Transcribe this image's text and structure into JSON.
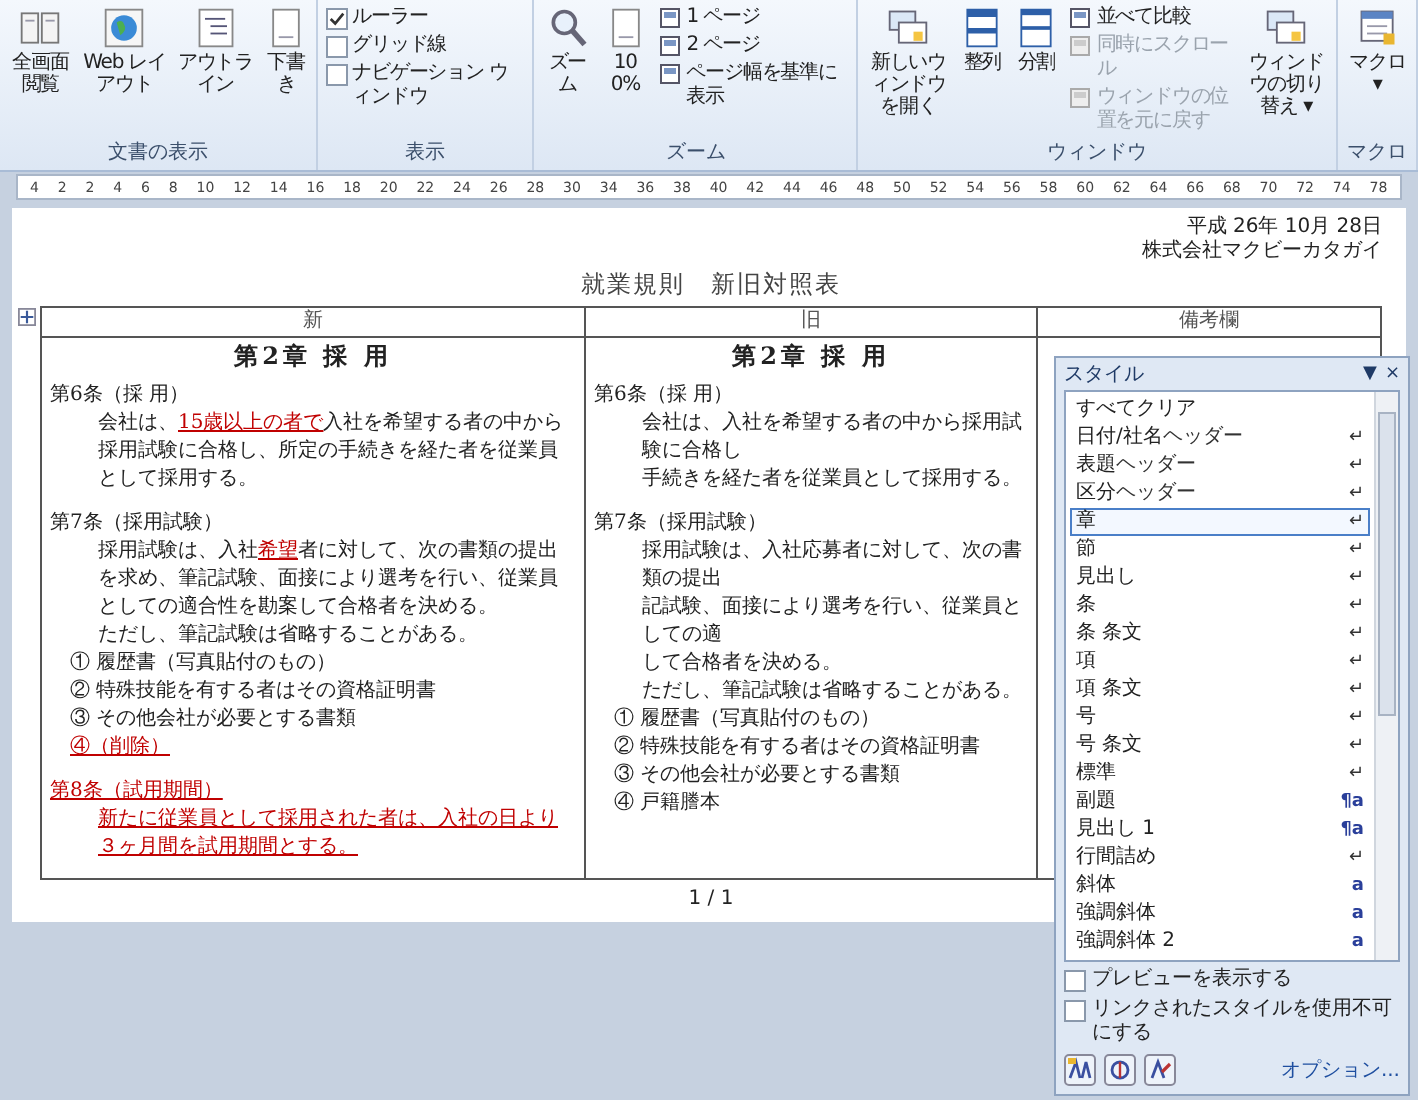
{
  "ribbon": {
    "groups": [
      {
        "label": "文書の表示",
        "columns": [
          {
            "kind": "large",
            "label": "全画面閲覧"
          },
          {
            "kind": "large",
            "label": "Web レイアウト"
          },
          {
            "kind": "large",
            "label": "アウトライン"
          },
          {
            "kind": "large",
            "label": "下書き"
          }
        ]
      },
      {
        "label": "表示",
        "columns": [
          {
            "kind": "stack",
            "items": [
              {
                "kind": "check",
                "label": "ルーラー",
                "checked": true
              },
              {
                "kind": "check",
                "label": "グリッド線",
                "checked": false
              },
              {
                "kind": "check",
                "label": "ナビゲーション ウィンドウ",
                "checked": false
              }
            ]
          }
        ]
      },
      {
        "label": "ズーム",
        "columns": [
          {
            "kind": "large",
            "label": "ズーム"
          },
          {
            "kind": "large",
            "label": "100%"
          },
          {
            "kind": "stack",
            "items": [
              {
                "kind": "small",
                "label": "1 ページ",
                "disabled": false
              },
              {
                "kind": "small",
                "label": "2 ページ",
                "disabled": false
              },
              {
                "kind": "small",
                "label": "ページ幅を基準に表示",
                "disabled": false
              }
            ]
          }
        ]
      },
      {
        "label": "ウィンドウ",
        "columns": [
          {
            "kind": "large",
            "label": "新しいウィンドウを開く"
          },
          {
            "kind": "large",
            "label": "整列"
          },
          {
            "kind": "large",
            "label": "分割"
          },
          {
            "kind": "stack",
            "items": [
              {
                "kind": "small",
                "label": "並べて比較",
                "disabled": false
              },
              {
                "kind": "small",
                "label": "同時にスクロール",
                "disabled": true
              },
              {
                "kind": "small",
                "label": "ウィンドウの位置を元に戻す",
                "disabled": true
              }
            ]
          },
          {
            "kind": "large",
            "label": "ウィンドウの切り替え ▾"
          }
        ]
      },
      {
        "label": "マクロ",
        "columns": [
          {
            "kind": "large",
            "label": "マクロ ▾"
          }
        ]
      }
    ]
  },
  "ruler": [
    "4",
    "2",
    "2",
    "4",
    "6",
    "8",
    "10",
    "12",
    "14",
    "16",
    "18",
    "20",
    "22",
    "24",
    "26",
    "28",
    "30",
    "34",
    "36",
    "38",
    "40",
    "42",
    "44",
    "46",
    "48",
    "50",
    "52",
    "54",
    "56",
    "58",
    "60",
    "62",
    "64",
    "66",
    "68",
    "70",
    "72",
    "74",
    "78"
  ],
  "document": {
    "date": "平成 26年 10月 28日",
    "company": "株式会社マクビーカタガイ",
    "title": "就業規則　新旧対照表",
    "columns": [
      {
        "header": "新",
        "lines": [
          {
            "kind": "chapter",
            "parts": [
              {
                "text": "第2章 採 用",
                "revised": false
              }
            ]
          },
          {
            "kind": "article",
            "parts": [
              {
                "text": "第6条（採 用）",
                "revised": false
              }
            ]
          },
          {
            "kind": "body",
            "parts": [
              {
                "text": "会社は、",
                "revised": false
              },
              {
                "text": "15歳以上の者で",
                "revised": true
              },
              {
                "text": "入社を希望する者の中から採用試験に合格し、所定の手続きを経た者を従業員として採用する。",
                "revised": false
              }
            ]
          },
          {
            "kind": "article",
            "parts": [
              {
                "text": "第7条（採用試験）",
                "revised": false
              }
            ]
          },
          {
            "kind": "body",
            "parts": [
              {
                "text": "採用試験は、入社",
                "revised": false
              },
              {
                "text": "希望",
                "revised": true
              },
              {
                "text": "者に対して、次の書類の提出を求め、筆記試験、面接により選考を行い、従業員としての適合性を勘案して合格者を決める。",
                "revised": false
              }
            ]
          },
          {
            "kind": "body",
            "parts": [
              {
                "text": "ただし、筆記試験は省略することがある。",
                "revised": false
              }
            ]
          },
          {
            "kind": "item",
            "parts": [
              {
                "text": "① 履歴書（写真貼付のもの）",
                "revised": false
              }
            ]
          },
          {
            "kind": "item",
            "parts": [
              {
                "text": "② 特殊技能を有する者はその資格証明書",
                "revised": false
              }
            ]
          },
          {
            "kind": "item",
            "parts": [
              {
                "text": "③ その他会社が必要とする書類",
                "revised": false
              }
            ]
          },
          {
            "kind": "item",
            "parts": [
              {
                "text": "④（削除）",
                "revised": true
              }
            ]
          },
          {
            "kind": "article",
            "parts": [
              {
                "text": "第8条（試用期間）",
                "revised": true
              }
            ]
          },
          {
            "kind": "body",
            "parts": [
              {
                "text": "新たに従業員として採用された者は、入社の日より３ヶ月間を試用期間とする。",
                "revised": true
              }
            ]
          }
        ]
      },
      {
        "header": "旧",
        "lines": [
          {
            "kind": "chapter",
            "parts": [
              {
                "text": "第2章 採 用",
                "revised": false
              }
            ]
          },
          {
            "kind": "article",
            "parts": [
              {
                "text": "第6条（採 用）",
                "revised": false
              }
            ]
          },
          {
            "kind": "body",
            "parts": [
              {
                "text": "会社は、入社を希望する者の中から採用試験に合格し",
                "revised": false
              }
            ]
          },
          {
            "kind": "body",
            "parts": [
              {
                "text": "手続きを経た者を従業員として採用する。",
                "revised": false
              }
            ]
          },
          {
            "kind": "article",
            "parts": [
              {
                "text": "第7条（採用試験）",
                "revised": false
              }
            ]
          },
          {
            "kind": "body",
            "parts": [
              {
                "text": "採用試験は、入社応募者に対して、次の書類の提出",
                "revised": false
              }
            ]
          },
          {
            "kind": "body",
            "parts": [
              {
                "text": "記試験、面接により選考を行い、従業員としての適",
                "revised": false
              }
            ]
          },
          {
            "kind": "body",
            "parts": [
              {
                "text": "して合格者を決める。",
                "revised": false
              }
            ]
          },
          {
            "kind": "body",
            "parts": [
              {
                "text": "ただし、筆記試験は省略することがある。",
                "revised": false
              }
            ]
          },
          {
            "kind": "item",
            "parts": [
              {
                "text": "① 履歴書（写真貼付のもの）",
                "revised": false
              }
            ]
          },
          {
            "kind": "item",
            "parts": [
              {
                "text": "② 特殊技能を有する者はその資格証明書",
                "revised": false
              }
            ]
          },
          {
            "kind": "item",
            "parts": [
              {
                "text": "③ その他会社が必要とする書類",
                "revised": false
              }
            ]
          },
          {
            "kind": "item",
            "parts": [
              {
                "text": "④ 戸籍謄本",
                "revised": false
              }
            ]
          }
        ]
      },
      {
        "header": "備考欄"
      }
    ],
    "footer": "1 / 1"
  },
  "styles_pane": {
    "title": "スタイル",
    "menu": "▼",
    "close": "×",
    "items": [
      {
        "label": "すべてクリア",
        "selected": false
      },
      {
        "label": "日付/社名",
        "tag": "ヘッダー",
        "kind": "paragraph",
        "symbol": "↵",
        "selected": false
      },
      {
        "label": "表題",
        "tag": "ヘッダー",
        "kind": "paragraph",
        "symbol": "↵",
        "selected": false
      },
      {
        "label": "区分",
        "tag": "ヘッダー",
        "kind": "paragraph",
        "symbol": "↵",
        "selected": false
      },
      {
        "label": "章",
        "kind": "paragraph",
        "symbol": "↵",
        "selected": true
      },
      {
        "label": "節",
        "kind": "paragraph",
        "symbol": "↵",
        "selected": false
      },
      {
        "label": "見出し",
        "kind": "paragraph",
        "symbol": "↵",
        "selected": false
      },
      {
        "label": "条",
        "kind": "paragraph",
        "symbol": "↵",
        "selected": false
      },
      {
        "label": "条 条文",
        "kind": "paragraph",
        "symbol": "↵",
        "selected": false
      },
      {
        "label": "項",
        "kind": "paragraph",
        "symbol": "↵",
        "selected": false
      },
      {
        "label": "項 条文",
        "kind": "paragraph",
        "symbol": "↵",
        "selected": false
      },
      {
        "label": "号",
        "kind": "paragraph",
        "symbol": "↵",
        "selected": false
      },
      {
        "label": "号 条文",
        "kind": "paragraph",
        "symbol": "↵",
        "selected": false
      },
      {
        "label": "標準",
        "kind": "paragraph",
        "symbol": "↵",
        "selected": false
      },
      {
        "label": "副題",
        "kind": "linked",
        "symbol": "¶a",
        "selected": false
      },
      {
        "label": "見出し 1",
        "kind": "linked",
        "symbol": "¶a",
        "selected": false
      },
      {
        "label": "行間詰め",
        "kind": "paragraph",
        "symbol": "↵",
        "selected": false
      },
      {
        "label": "斜体",
        "kind": "character",
        "symbol": "a",
        "selected": false
      },
      {
        "label": "強調斜体",
        "kind": "character",
        "symbol": "a",
        "selected": false
      },
      {
        "label": "強調斜体 2",
        "kind": "character",
        "symbol": "a",
        "selected": false
      }
    ],
    "options": [
      {
        "label": "プレビューを表示する",
        "checked": false
      },
      {
        "label": "リンクされたスタイルを使用不可にする",
        "checked": false
      }
    ],
    "link": "オプション..."
  }
}
